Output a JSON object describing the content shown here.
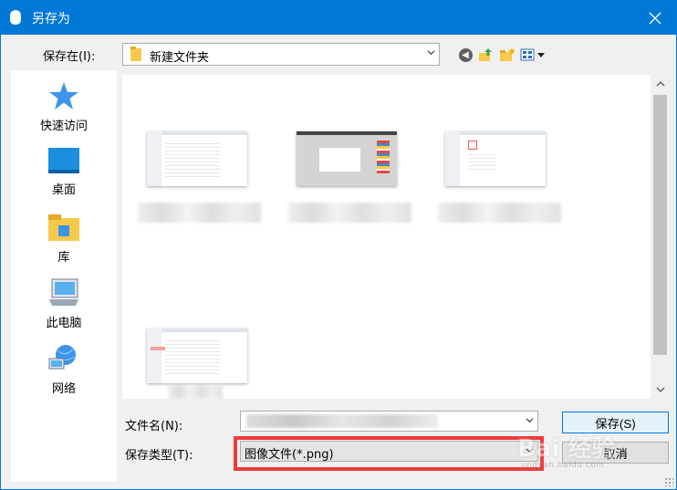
{
  "window": {
    "title": "另存为"
  },
  "lookin": {
    "label": "保存在(I):",
    "value": "新建文件夹"
  },
  "places": [
    {
      "label": "快速访问",
      "icon": "star-icon"
    },
    {
      "label": "桌面",
      "icon": "desktop-icon"
    },
    {
      "label": "库",
      "icon": "library-icon"
    },
    {
      "label": "此电脑",
      "icon": "computer-icon"
    },
    {
      "label": "网络",
      "icon": "network-icon"
    }
  ],
  "filename": {
    "label": "文件名(N):"
  },
  "filetype": {
    "label": "保存类型(T):",
    "value": "图像文件(*.png)"
  },
  "buttons": {
    "save": "保存(S)",
    "cancel": "取消"
  },
  "watermark": {
    "text": "Bai 经验",
    "sub": "jingyan.baidu.com"
  },
  "colors": {
    "accent": "#0078d7",
    "highlight": "#f23c3c"
  }
}
